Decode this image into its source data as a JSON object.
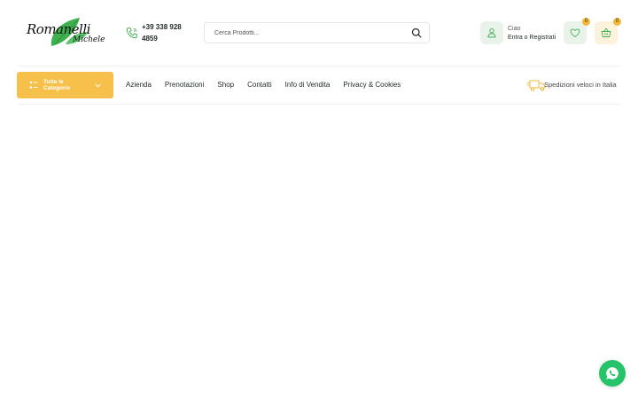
{
  "logo": {
    "name": "Romanelli",
    "sub": "Michele"
  },
  "contact": {
    "phone": "+39 338 928 4859"
  },
  "search": {
    "placeholder": "Cerca Prodotti..."
  },
  "account": {
    "greeting": "Ciao",
    "action": "Entra o Registrati"
  },
  "wishlist": {
    "count": "0"
  },
  "cart": {
    "count": "0"
  },
  "categories": {
    "label": "Tutte le Categorie"
  },
  "nav": {
    "items": [
      {
        "label": "Azienda"
      },
      {
        "label": "Prenotazioni"
      },
      {
        "label": "Shop"
      },
      {
        "label": "Contatti"
      },
      {
        "label": "Info di Vendita"
      },
      {
        "label": "Privacy & Cookies"
      }
    ]
  },
  "shipping": {
    "text": "Spedizioni veloci in Italia"
  },
  "colors": {
    "accent_yellow": "#f6c04a",
    "accent_green": "#3fb04f",
    "whatsapp_green": "#25c36a",
    "icon_bg_green": "#e9f3ea",
    "icon_bg_yellow": "#fdf2dc"
  },
  "icons": {
    "phone": "phone-icon",
    "search": "search-icon",
    "account": "user-icon",
    "wishlist": "heart-icon",
    "cart": "basket-icon",
    "categories": "grid-icon",
    "chevron": "chevron-down-icon",
    "shipping": "truck-icon",
    "chat": "whatsapp-icon"
  }
}
